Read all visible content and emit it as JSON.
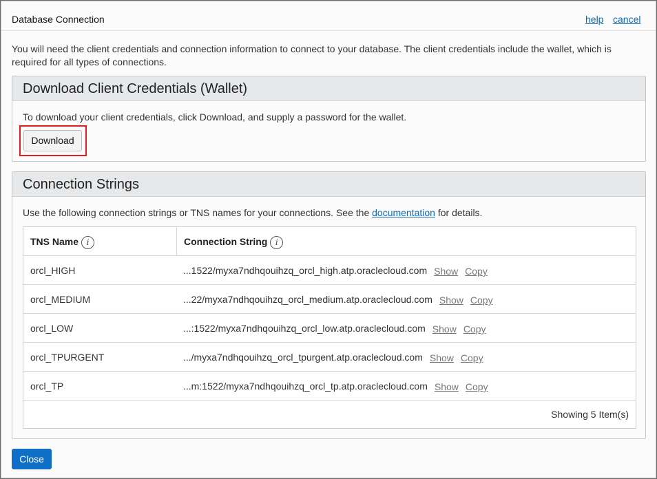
{
  "dialog": {
    "title": "Database Connection",
    "help_label": "help",
    "cancel_label": "cancel",
    "intro": "You will need the client credentials and connection information to connect to your database. The client credentials include the wallet, which is required for all types of connections."
  },
  "credentials": {
    "heading": "Download Client Credentials (Wallet)",
    "instructions": "To download your client credentials, click Download, and supply a password for the wallet.",
    "download_label": "Download"
  },
  "connections": {
    "heading": "Connection Strings",
    "text_before": "Use the following connection strings or TNS names for your connections. See the ",
    "doc_link": "documentation",
    "text_after": " for details.",
    "columns": {
      "tns_name": "TNS Name",
      "connection_string": "Connection String"
    },
    "rows": [
      {
        "name": "orcl_HIGH",
        "conn": "...1522/myxa7ndhqouihzq_orcl_high.atp.oraclecloud.com",
        "show": "Show",
        "copy": "Copy"
      },
      {
        "name": "orcl_MEDIUM",
        "conn": "...22/myxa7ndhqouihzq_orcl_medium.atp.oraclecloud.com",
        "show": "Show",
        "copy": "Copy"
      },
      {
        "name": "orcl_LOW",
        "conn": "...:1522/myxa7ndhqouihzq_orcl_low.atp.oraclecloud.com",
        "show": "Show",
        "copy": "Copy"
      },
      {
        "name": "orcl_TPURGENT",
        "conn": ".../myxa7ndhqouihzq_orcl_tpurgent.atp.oraclecloud.com",
        "show": "Show",
        "copy": "Copy"
      },
      {
        "name": "orcl_TP",
        "conn": "...m:1522/myxa7ndhqouihzq_orcl_tp.atp.oraclecloud.com",
        "show": "Show",
        "copy": "Copy"
      }
    ],
    "footer": "Showing 5 Item(s)"
  },
  "close_label": "Close",
  "icons": {
    "info": "info-icon"
  },
  "colors": {
    "link": "#0f6bb4",
    "primary_button": "#0f6fc6",
    "highlight_border": "#e02020"
  }
}
